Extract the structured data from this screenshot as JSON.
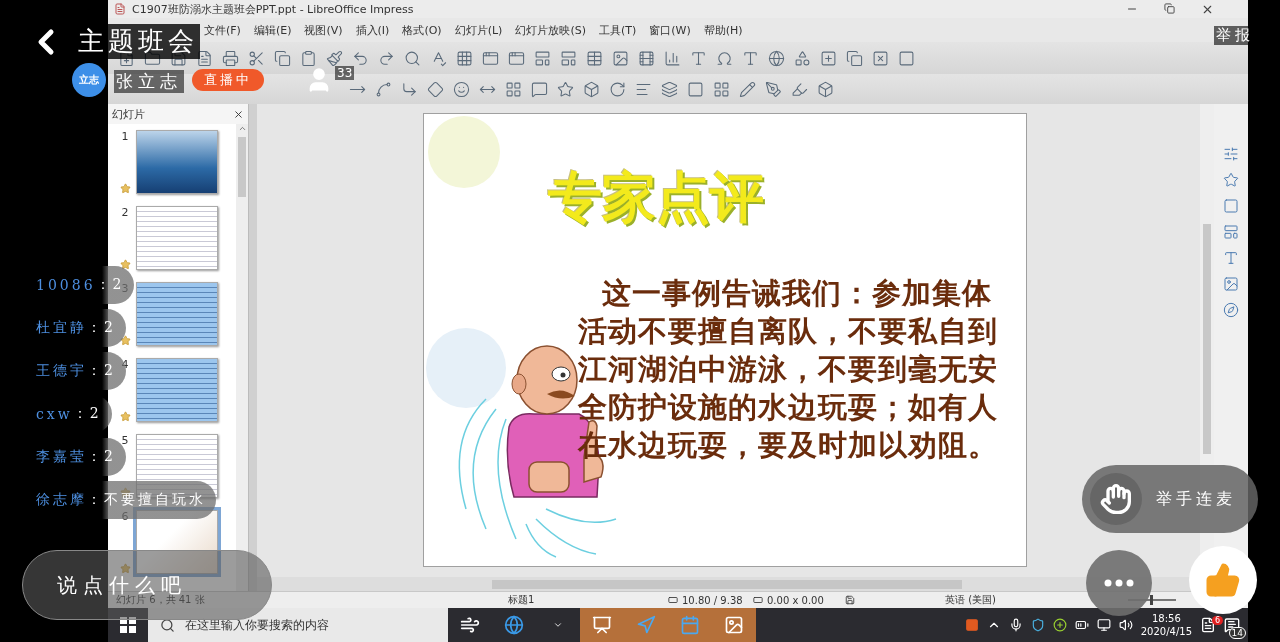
{
  "live": {
    "title": "主题班会",
    "host_avatar_text": "立志",
    "host": "张立志",
    "status": "直播中",
    "viewers": "33",
    "report": "举报"
  },
  "chat": [
    {
      "user": "10086",
      "separator": "：",
      "text": "2"
    },
    {
      "user": "杜宜静",
      "separator": "：",
      "text": "2"
    },
    {
      "user": "王德宇",
      "separator": "：",
      "text": "2"
    },
    {
      "user": "cxw",
      "separator": "：",
      "text": "2"
    },
    {
      "user": "李嘉莹",
      "separator": "：",
      "text": "2"
    },
    {
      "user": "徐志摩",
      "separator": "：",
      "text": "不要擅自玩水"
    }
  ],
  "comment": {
    "placeholder": "说点什么吧"
  },
  "raise_hand": "举手连麦",
  "app": {
    "window_title": "C1907班防溺水主题班会PPT.ppt - LibreOffice Impress",
    "menu": [
      "文件(F)",
      "编辑(E)",
      "视图(V)",
      "插入(I)",
      "格式(O)",
      "幻灯片(L)",
      "幻灯片放映(S)",
      "工具(T)",
      "窗口(W)",
      "帮助(H)"
    ],
    "slides_panel": {
      "title": "幻灯片",
      "slides": [
        {
          "number": "1",
          "kind": "photo",
          "selected": false
        },
        {
          "number": "2",
          "kind": "text-white",
          "selected": false
        },
        {
          "number": "3",
          "kind": "text-blue",
          "selected": false
        },
        {
          "number": "4",
          "kind": "text-blue",
          "selected": false
        },
        {
          "number": "5",
          "kind": "text-white",
          "selected": false
        },
        {
          "number": "6",
          "kind": "current",
          "selected": true
        }
      ]
    },
    "slide": {
      "title": "专家点评",
      "body": "这一事例告诫我们：参加集体活动不要擅自离队，不要私自到江河湖泊中游泳，不要到毫无安全防护设施的水边玩耍；如有人在水边玩耍，要及时加以劝阻。"
    },
    "status_bar": {
      "slide_info": "幻灯片 6，共 41 张",
      "layout": "标题1",
      "position": "10.80 / 9.38",
      "size": "0.00 x 0.00",
      "language": "英语 (美国)",
      "zoom": {
        "level": 0.45
      }
    }
  },
  "taskbar": {
    "search_placeholder": "在这里输入你要搜索的内容",
    "time": "18:56",
    "date": "2020/4/15",
    "notifications": "6",
    "action_center": "14"
  }
}
